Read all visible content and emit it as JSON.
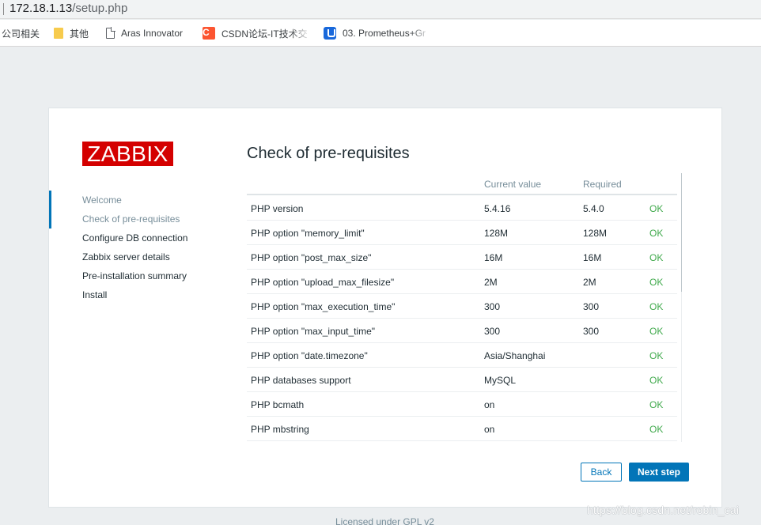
{
  "browser": {
    "url_host": "172.18.1.13",
    "url_path": "/setup.php"
  },
  "bookmarks": [
    {
      "label": "公司相关",
      "icon": "none"
    },
    {
      "label": "其他",
      "icon": "folder-icon"
    },
    {
      "label": "Aras Innovator",
      "icon": "page-icon"
    },
    {
      "label": "CSDN论坛-IT技术交",
      "icon": "csdn-icon"
    },
    {
      "label": "03. Prometheus+Gr",
      "icon": "prometheus-icon"
    }
  ],
  "logo": "ZABBIX",
  "steps": [
    {
      "label": "Welcome",
      "state": "done"
    },
    {
      "label": "Check of pre-requisites",
      "state": "current"
    },
    {
      "label": "Configure DB connection",
      "state": "todo"
    },
    {
      "label": "Zabbix server details",
      "state": "todo"
    },
    {
      "label": "Pre-installation summary",
      "state": "todo"
    },
    {
      "label": "Install",
      "state": "todo"
    }
  ],
  "page_title": "Check of pre-requisites",
  "table": {
    "headers": {
      "current": "Current value",
      "required": "Required"
    },
    "rows": [
      {
        "name": "PHP version",
        "current": "5.4.16",
        "required": "5.4.0",
        "status": "OK"
      },
      {
        "name": "PHP option \"memory_limit\"",
        "current": "128M",
        "required": "128M",
        "status": "OK"
      },
      {
        "name": "PHP option \"post_max_size\"",
        "current": "16M",
        "required": "16M",
        "status": "OK"
      },
      {
        "name": "PHP option \"upload_max_filesize\"",
        "current": "2M",
        "required": "2M",
        "status": "OK"
      },
      {
        "name": "PHP option \"max_execution_time\"",
        "current": "300",
        "required": "300",
        "status": "OK"
      },
      {
        "name": "PHP option \"max_input_time\"",
        "current": "300",
        "required": "300",
        "status": "OK"
      },
      {
        "name": "PHP option \"date.timezone\"",
        "current": "Asia/Shanghai",
        "required": "",
        "status": "OK"
      },
      {
        "name": "PHP databases support",
        "current": "MySQL",
        "required": "",
        "status": "OK"
      },
      {
        "name": "PHP bcmath",
        "current": "on",
        "required": "",
        "status": "OK"
      },
      {
        "name": "PHP mbstring",
        "current": "on",
        "required": "",
        "status": "OK"
      }
    ]
  },
  "buttons": {
    "back": "Back",
    "next": "Next step"
  },
  "footer": "Licensed under GPL v2",
  "watermark": "https://blog.csdn.net/robin_cai",
  "colors": {
    "brand": "#d40000",
    "accent": "#0275b8",
    "ok": "#3fa94b",
    "background": "#ebeef0"
  }
}
